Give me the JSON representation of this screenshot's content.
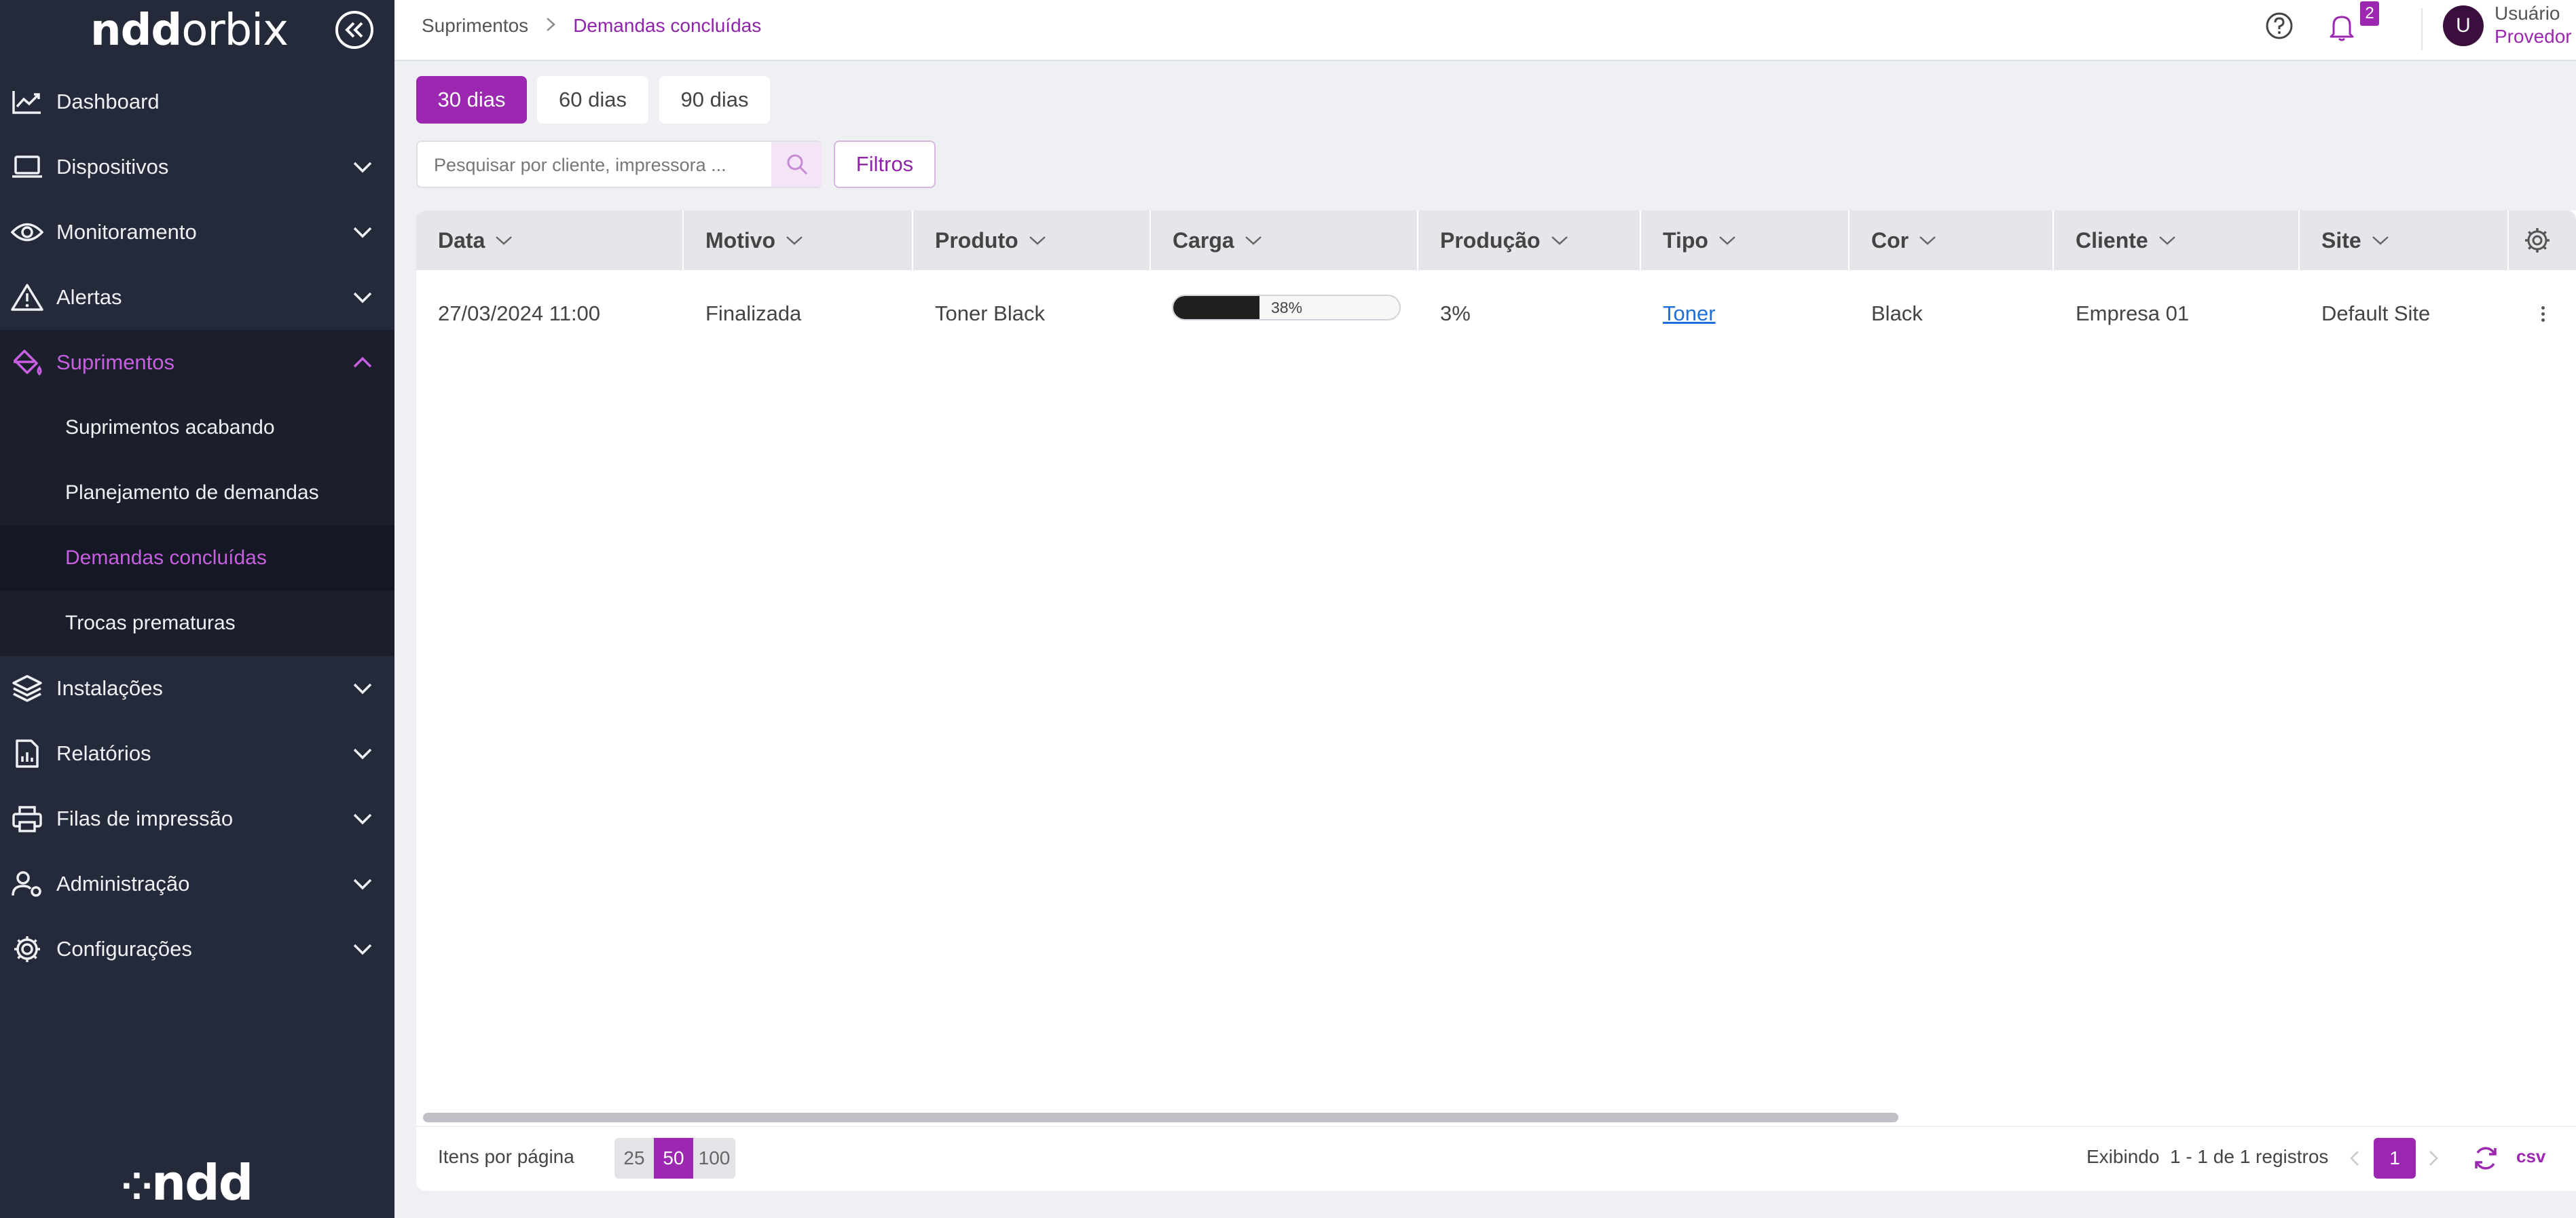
{
  "app": {
    "logo_a": "ndd",
    "logo_b": "orbix",
    "bottom_logo": "ndd"
  },
  "colors": {
    "accent": "#9c27b0",
    "sidebar_bg": "#242a3a",
    "link": "#1e6fd9"
  },
  "sidebar": {
    "items": [
      {
        "label": "Dashboard",
        "icon": "chart-line-icon"
      },
      {
        "label": "Dispositivos",
        "icon": "laptop-icon"
      },
      {
        "label": "Monitoramento",
        "icon": "eye-icon"
      },
      {
        "label": "Alertas",
        "icon": "warning-icon"
      },
      {
        "label": "Suprimentos",
        "icon": "ink-bucket-icon"
      },
      {
        "label": "Instalações",
        "icon": "layers-icon"
      },
      {
        "label": "Relatórios",
        "icon": "report-icon"
      },
      {
        "label": "Filas de impressão",
        "icon": "printer-icon"
      },
      {
        "label": "Administração",
        "icon": "user-gear-icon"
      },
      {
        "label": "Configurações",
        "icon": "gear-icon"
      }
    ],
    "subitems": [
      {
        "label": "Suprimentos acabando"
      },
      {
        "label": "Planejamento de demandas"
      },
      {
        "label": "Demandas concluídas"
      },
      {
        "label": "Trocas prematuras"
      }
    ]
  },
  "header": {
    "breadcrumb": [
      "Suprimentos",
      "Demandas concluídas"
    ],
    "notification_count": "2",
    "user_initial": "U",
    "user_name": "Usuário",
    "user_role": "Provedor"
  },
  "period_tabs": [
    "30 dias",
    "60 dias",
    "90 dias"
  ],
  "search": {
    "placeholder": "Pesquisar por cliente, impressora ..."
  },
  "filters_label": "Filtros",
  "table": {
    "columns": [
      "Data",
      "Motivo",
      "Produto",
      "Carga",
      "Produção",
      "Tipo",
      "Cor",
      "Cliente",
      "Site"
    ],
    "rows": [
      {
        "data": "27/03/2024 11:00",
        "motivo": "Finalizada",
        "produto": "Toner Black",
        "carga": "38%",
        "carga_fraction": 0.38,
        "producao": "3%",
        "tipo": "Toner",
        "cor": "Black",
        "cliente": "Empresa 01",
        "site": "Default Site"
      }
    ]
  },
  "footer": {
    "per_page_label": "Itens por página",
    "per_page_options": [
      "25",
      "50",
      "100"
    ],
    "showing": "Exibindo  1 - 1 de 1 registros",
    "current_page": "1",
    "csv": "csv"
  }
}
